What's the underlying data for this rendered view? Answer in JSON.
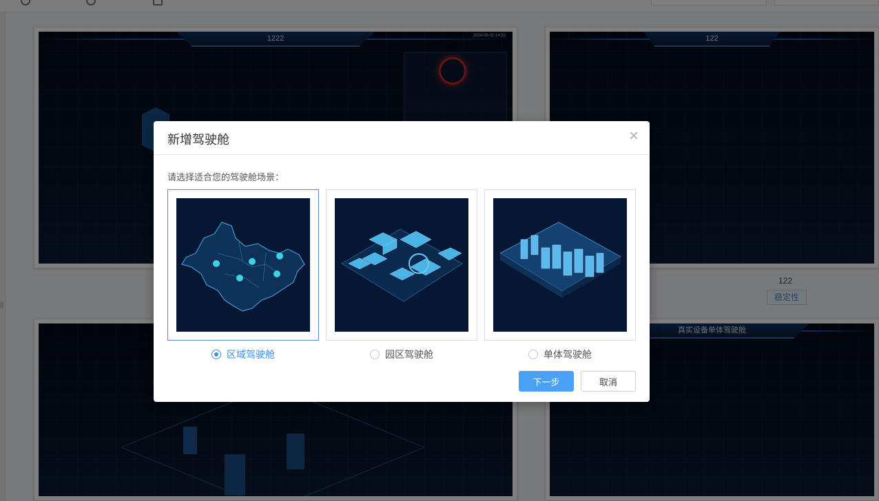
{
  "background": {
    "cards": [
      {
        "title": "1222",
        "timestamp": "2024-08-01 14:52"
      },
      {
        "title": "122",
        "caption": "122",
        "tag": "稳定性"
      },
      {
        "title": ""
      },
      {
        "title": "真实设备单体驾驶舱"
      }
    ],
    "rail_glyph": "||"
  },
  "modal": {
    "title": "新增驾驶舱",
    "close_glyph": "×",
    "prompt": "请选择适合您的驾驶舱场景：",
    "options": [
      {
        "label": "区域驾驶舱",
        "thumbnail": "region-map-icon",
        "selected": true
      },
      {
        "label": "园区驾驶舱",
        "thumbnail": "campus-isometric-icon",
        "selected": false
      },
      {
        "label": "单体驾驶舱",
        "thumbnail": "single-room-isometric-icon",
        "selected": false
      }
    ],
    "next_label": "下一步",
    "cancel_label": "取消"
  },
  "colors": {
    "accent": "#4aa0f5",
    "selected_text": "#3c8ee6",
    "thumb_bg": "#061633"
  }
}
